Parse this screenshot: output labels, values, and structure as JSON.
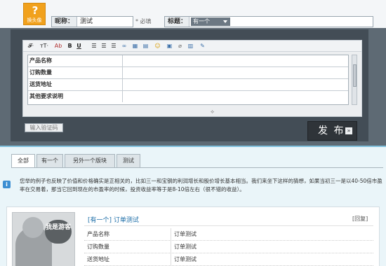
{
  "header": {
    "avatar_label": "换头像",
    "nickname_label": "昵称：",
    "nickname_value": "测试",
    "required_text": "* 必填",
    "title_label": "标题：",
    "title_select_value": "有一个",
    "title_input_value": ""
  },
  "editor": {
    "toolbar": [
      {
        "name": "font-family",
        "glyph": "𝓕·"
      },
      {
        "name": "font-size",
        "glyph": "тT·"
      },
      {
        "name": "font-color",
        "glyph": "Ab"
      },
      {
        "name": "bold",
        "glyph": "B"
      },
      {
        "name": "underline",
        "glyph": "U"
      },
      {
        "name": "align-left",
        "glyph": "☰"
      },
      {
        "name": "align-center",
        "glyph": "☰"
      },
      {
        "name": "align-right",
        "glyph": "☰"
      },
      {
        "name": "link",
        "glyph": "∞"
      },
      {
        "name": "table",
        "glyph": "▦"
      },
      {
        "name": "insert-block",
        "glyph": "▤"
      },
      {
        "name": "emoticon",
        "glyph": "☺"
      },
      {
        "name": "image",
        "glyph": "▣"
      },
      {
        "name": "attachment",
        "glyph": "⌀"
      },
      {
        "name": "media",
        "glyph": "▥"
      },
      {
        "name": "edit",
        "glyph": "✎"
      }
    ],
    "rows": [
      {
        "label": "产品名称",
        "value": ""
      },
      {
        "label": "订购数量",
        "value": ""
      },
      {
        "label": "送货地址",
        "value": ""
      },
      {
        "label": "其他要求说明",
        "value": ""
      }
    ],
    "resize_handle": "⟡"
  },
  "captcha_placeholder": "输入验证码",
  "publish_label": "发 布",
  "publish_arrow": "»",
  "tabs": [
    {
      "label": "全部",
      "active": true
    },
    {
      "label": "有一个",
      "active": false
    },
    {
      "label": "另外一个版块",
      "active": false
    },
    {
      "label": "测试",
      "active": false
    }
  ],
  "info": {
    "icon": "i",
    "text": "您举的例子也反映了价值和价格确实是正相关的，比如三一和宝钢的利润增长和股价增长基本相当。我们来坐下这样的猜想，如果当初三一是以40-50倍市盈率在交易着，那当它回到现在的市盈率的时候，投资收益率等于是8-10倍左右（很不错的收益）。"
  },
  "post": {
    "avatar_text": "我是游客",
    "title": "[有一个] 订单测试",
    "reply_label": "[回复]",
    "details": [
      {
        "key": "产品名称",
        "value": "订单测试"
      },
      {
        "key": "订购数量",
        "value": "订单测试"
      },
      {
        "key": "送货地址",
        "value": "订单测试"
      }
    ]
  },
  "colors": {
    "panel": "#434d56",
    "accent": "#f1a11d",
    "link": "#1f6fa8",
    "info_icon": "#3b8ed2"
  }
}
